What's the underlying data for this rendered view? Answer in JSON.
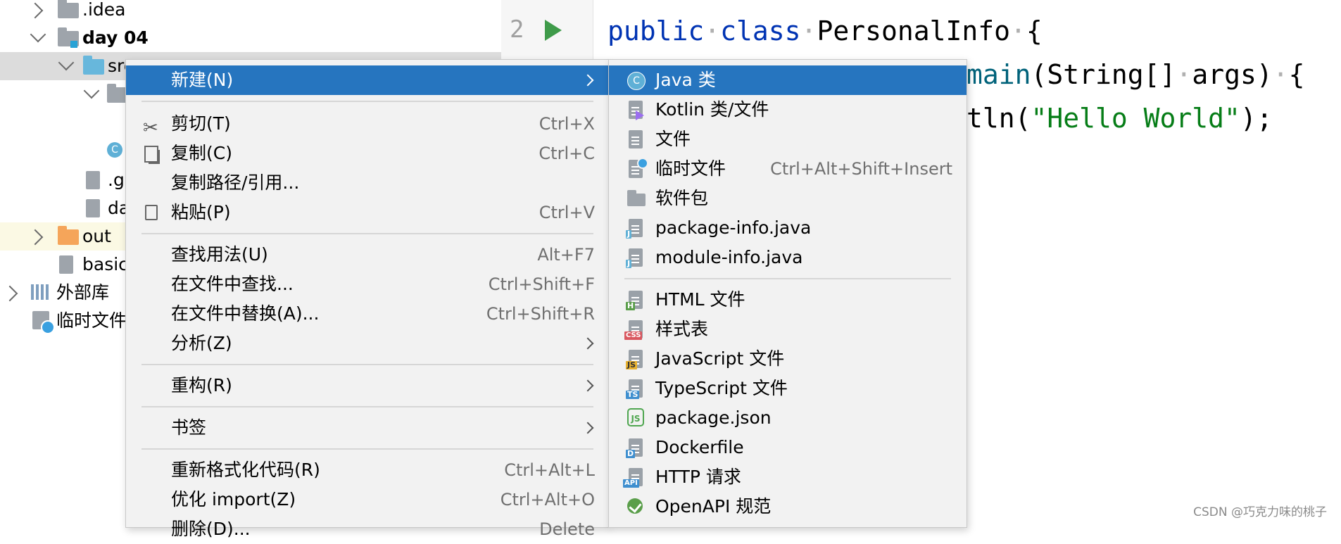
{
  "tree": {
    "items": [
      {
        "label": ".idea"
      },
      {
        "label": "day 04"
      },
      {
        "label": "src"
      },
      {
        "label": ""
      },
      {
        "label": ".gi"
      },
      {
        "label": "da"
      },
      {
        "label": "out"
      },
      {
        "label": "basic"
      },
      {
        "label": "外部库"
      },
      {
        "label": "临时文件"
      }
    ]
  },
  "editor": {
    "line_number": "2",
    "lines": {
      "l1_kw1": "public",
      "l1_kw2": "class",
      "l1_name": "PersonalInfo",
      "l1_brace": "{",
      "l2_fn": "main",
      "l2_rest": "(String[]",
      "l2_args": "args)",
      "l2_brace": "{",
      "l3_pre": "tln(",
      "l3_str": "\"Hello World\"",
      "l3_post": ");"
    }
  },
  "menu": {
    "items": [
      {
        "label": "新建(N)",
        "shortcut": ""
      },
      {
        "label": "剪切(T)",
        "shortcut": "Ctrl+X"
      },
      {
        "label": "复制(C)",
        "shortcut": "Ctrl+C"
      },
      {
        "label": "复制路径/引用...",
        "shortcut": ""
      },
      {
        "label": "粘贴(P)",
        "shortcut": "Ctrl+V"
      },
      {
        "label": "查找用法(U)",
        "shortcut": "Alt+F7"
      },
      {
        "label": "在文件中查找...",
        "shortcut": "Ctrl+Shift+F"
      },
      {
        "label": "在文件中替换(A)...",
        "shortcut": "Ctrl+Shift+R"
      },
      {
        "label": "分析(Z)",
        "shortcut": ""
      },
      {
        "label": "重构(R)",
        "shortcut": ""
      },
      {
        "label": "书签",
        "shortcut": ""
      },
      {
        "label": "重新格式化代码(R)",
        "shortcut": "Ctrl+Alt+L"
      },
      {
        "label": "优化 import(Z)",
        "shortcut": "Ctrl+Alt+O"
      },
      {
        "label": "删除(D)...",
        "shortcut": "Delete"
      }
    ]
  },
  "submenu": {
    "items": [
      {
        "label": "Java 类",
        "shortcut": "",
        "badge": "C"
      },
      {
        "label": "Kotlin 类/文件",
        "shortcut": "",
        "badge": ""
      },
      {
        "label": "文件",
        "shortcut": "",
        "badge": ""
      },
      {
        "label": "临时文件",
        "shortcut": "Ctrl+Alt+Shift+Insert",
        "badge": ""
      },
      {
        "label": "软件包",
        "shortcut": "",
        "badge": ""
      },
      {
        "label": "package-info.java",
        "shortcut": "",
        "badge": "J"
      },
      {
        "label": "module-info.java",
        "shortcut": "",
        "badge": "J"
      },
      {
        "label": "HTML 文件",
        "shortcut": "",
        "badge": "H"
      },
      {
        "label": "样式表",
        "shortcut": "",
        "badge": "CSS"
      },
      {
        "label": "JavaScript 文件",
        "shortcut": "",
        "badge": "JS"
      },
      {
        "label": "TypeScript 文件",
        "shortcut": "",
        "badge": "TS"
      },
      {
        "label": "package.json",
        "shortcut": "",
        "badge": "JS"
      },
      {
        "label": "Dockerfile",
        "shortcut": "",
        "badge": "D"
      },
      {
        "label": "HTTP 请求",
        "shortcut": "",
        "badge": "API"
      },
      {
        "label": "OpenAPI 规范",
        "shortcut": "",
        "badge": ""
      }
    ]
  },
  "watermark": "CSDN @巧克力味的桃子",
  "colors": {
    "accent": "#2675bf",
    "keyword": "#0033b3",
    "string": "#067d17",
    "run": "#3f9b4a"
  }
}
